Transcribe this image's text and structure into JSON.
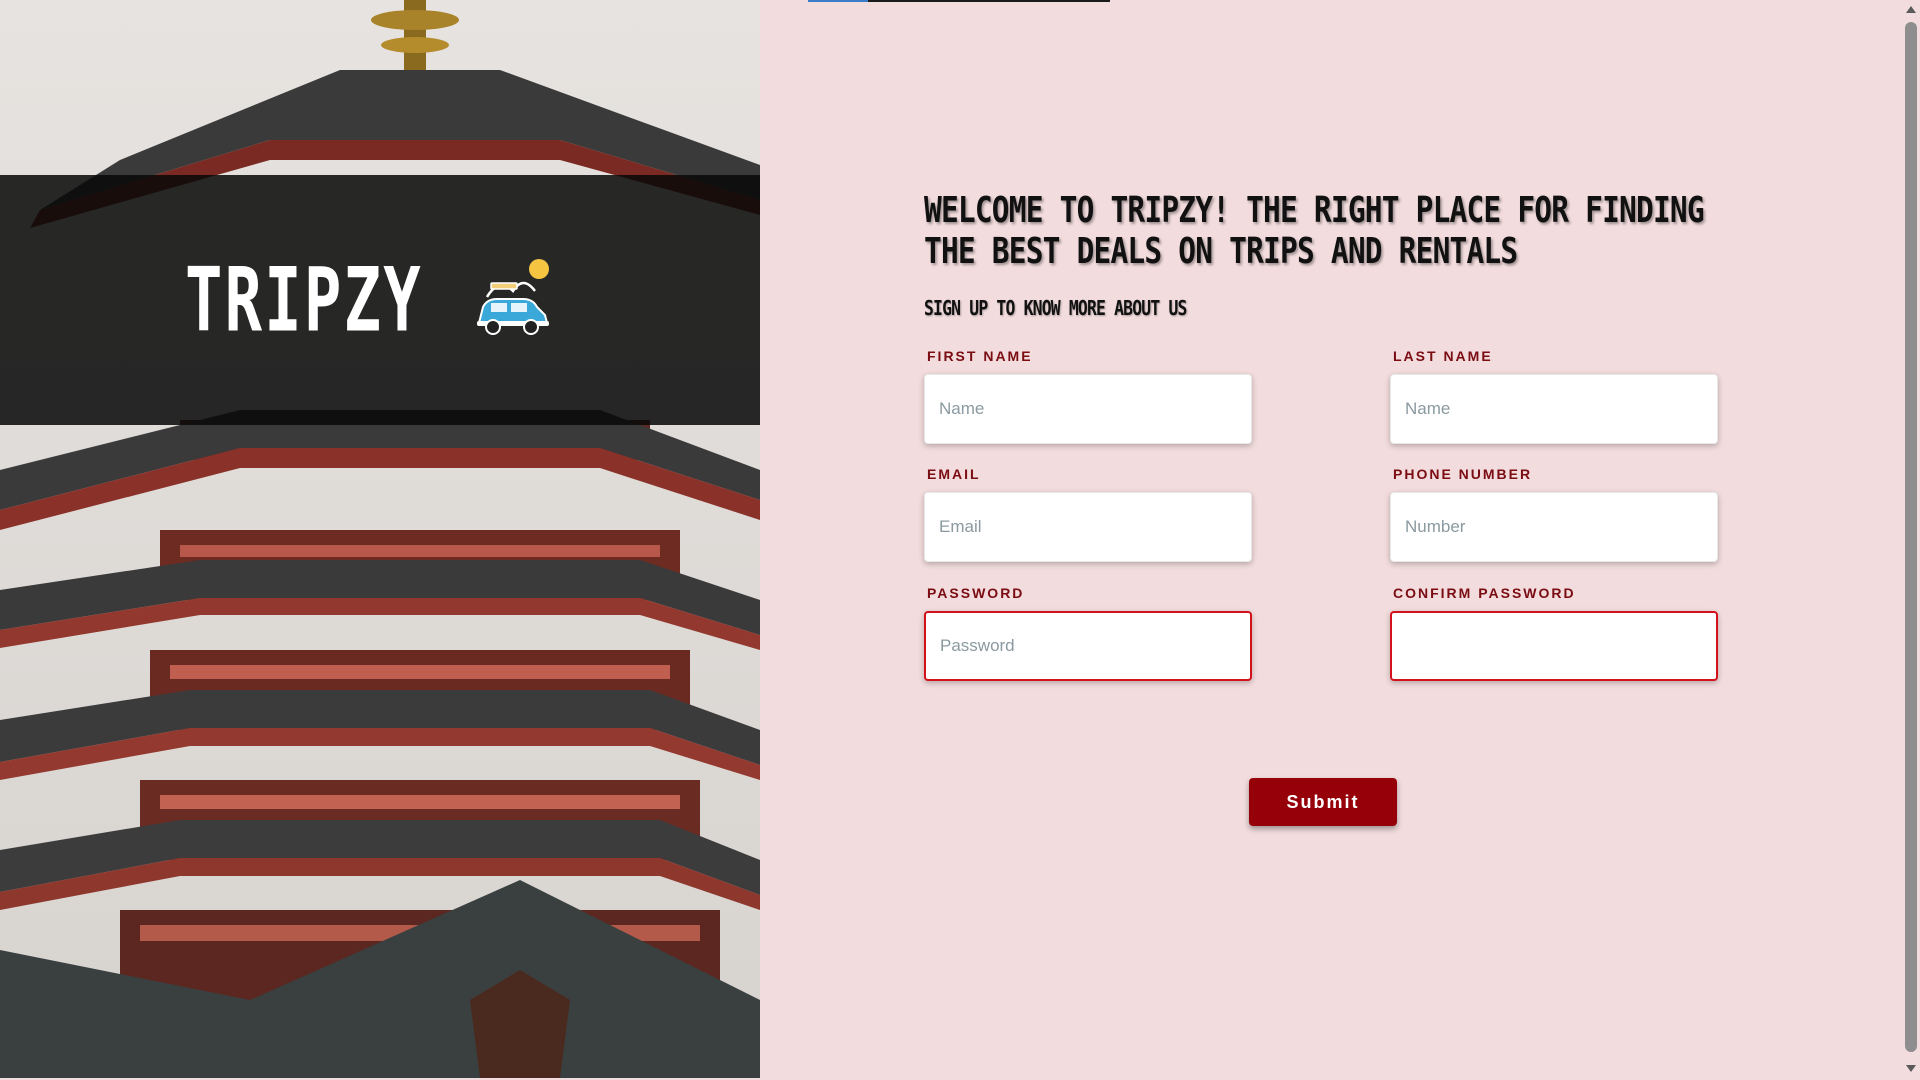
{
  "brand": {
    "title": "TRIPZY",
    "logo_icon": "car-travel-icon"
  },
  "form": {
    "heading": "Welcome to Tripzy! The right place for finding the best deals on trips and rentals",
    "subheading": "Sign up to know more about us",
    "fields": {
      "first_name": {
        "label": "First Name",
        "placeholder": "Name",
        "value": ""
      },
      "last_name": {
        "label": "Last Name",
        "placeholder": "Name",
        "value": ""
      },
      "email": {
        "label": "Email",
        "placeholder": "Email",
        "value": ""
      },
      "phone": {
        "label": "Phone Number",
        "placeholder": "Number",
        "value": ""
      },
      "password": {
        "label": "Password",
        "placeholder": "Password",
        "value": ""
      },
      "confirm_password": {
        "label": "Confirm Password",
        "placeholder": "",
        "value": ""
      }
    },
    "submit_label": "Submit"
  },
  "colors": {
    "page_background": "#f2dcdd",
    "label_color": "#7a0c12",
    "submit_background": "#960008",
    "invalid_border": "#d3121c",
    "brand_band": "#080808"
  }
}
